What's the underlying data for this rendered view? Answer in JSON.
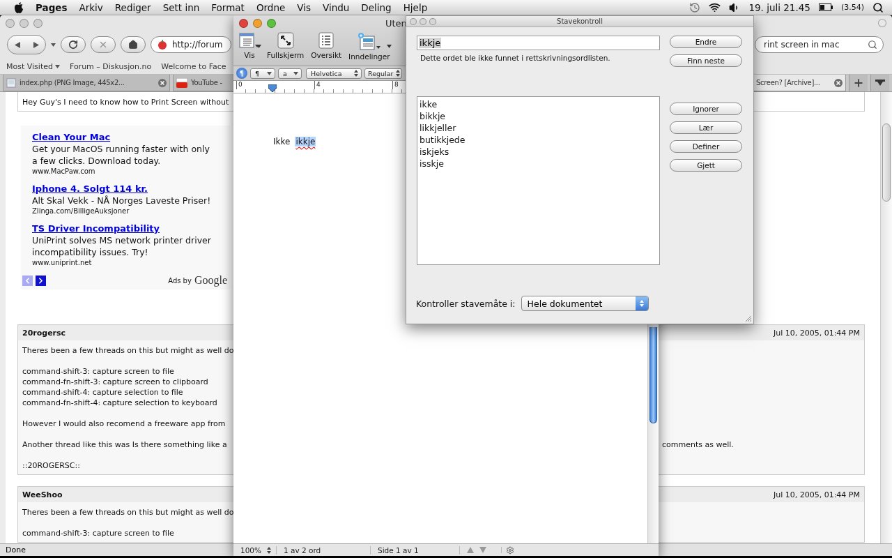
{
  "menu_bar": {
    "app": "Pages",
    "items": [
      "Arkiv",
      "Rediger",
      "Sett inn",
      "Format",
      "Ordne",
      "Vis",
      "Vindu",
      "Deling",
      "Hjelp"
    ],
    "clock": "19. juli 21.45",
    "battery": "(3.54)"
  },
  "browser": {
    "url": "http://forum",
    "search": "rint screen in mac",
    "bookmarks": [
      {
        "label": "Most Visited",
        "menu": true
      },
      {
        "label": "Forum – Diskusjon.no",
        "menu": false
      },
      {
        "label": "Welcome to Face",
        "menu": false
      }
    ],
    "tabs": [
      {
        "label": "index.php (PNG Image, 445x2...",
        "kind": "image",
        "selected": false,
        "close_button": true
      },
      {
        "label": "YouTube -",
        "kind": "video",
        "selected": false
      },
      {
        "label": "Screen? [Archive]...",
        "kind": "page",
        "selected": true,
        "close_button": true
      }
    ],
    "first_post_tail": "Hey Guy's I need to know how to Print Screen without",
    "ads": [
      {
        "title": "Clean Your Mac",
        "text": "Get your MacOS running faster with only a few clicks. Download today.",
        "url": "www.MacPaw.com"
      },
      {
        "title": "Iphone 4. Solgt 114 kr.",
        "text": "Alt Skal Vekk - NÅ Norges Laveste Priser!",
        "url": "Zlinga.com/BilligeAuksjoner"
      },
      {
        "title": "TS Driver Incompatibility",
        "text": "UniPrint solves MS network printer driver incompatibility issues. Try!",
        "url": "www.uniprint.net"
      }
    ],
    "ads_label": "Ads by",
    "ads_brand": "Google",
    "posts": [
      {
        "author": "20rogersc",
        "date": "Jul 10, 2005, 01:44 PM",
        "paragraphs": [
          {
            "lines": [
              "Theres been a few threads on this but might as well do"
            ]
          },
          {
            "lines": [
              "command-shift-3: capture screen to file",
              "command-fn-shift-3: capture screen to clipboard",
              "command-shift-4: capture selection to file",
              "command-fn-shift-4: capture selection to keyboard"
            ]
          },
          {
            "lines": [
              "However I would also recomend a freeware app from"
            ]
          },
          {
            "lines": [
              "Another thread like this was Is there something like a"
            ],
            "continued": "comments as well."
          },
          {
            "lines": [
              "::20ROGERSC::"
            ]
          }
        ]
      },
      {
        "author": "WeeShoo",
        "date": "Jul 10, 2005, 01:44 PM",
        "paragraphs": [
          {
            "lines": [
              "Theres been a few threads on this but might as well do"
            ]
          },
          {
            "lines": [
              "command-shift-3: capture screen to file"
            ]
          }
        ]
      }
    ],
    "status": "Done"
  },
  "pages": {
    "title": "Uten",
    "toolbar": [
      {
        "label": "Vis",
        "kind": "view",
        "menu": true
      },
      {
        "label": "Fullskjerm",
        "kind": "fullscreen",
        "menu": false
      },
      {
        "label": "Oversikt",
        "kind": "inspector",
        "menu": false
      },
      {
        "label": "Inndelinger",
        "kind": "sections",
        "menu": true
      }
    ],
    "format_bar": {
      "paragraph_button": "¶",
      "paragraph_style": "¶",
      "char_style": "a",
      "font": "Helvetica",
      "typeface": "Regular"
    },
    "ruler": [
      "0",
      "4",
      "8"
    ],
    "document": [
      {
        "text": "Ikke",
        "misspelled": false,
        "selected": false
      },
      {
        "text": "ikkje",
        "misspelled": true,
        "selected": true
      }
    ],
    "status": {
      "zoom": "100%",
      "words": "1 av 2 ord",
      "page": "Side 1 av 1"
    }
  },
  "spelling": {
    "title": "Stavekontroll",
    "word": "ikkje",
    "word_selected": true,
    "message": "Dette ordet ble ikke funnet i rettskrivningsordlisten.",
    "top_buttons": [
      "Endre",
      "Finn neste"
    ],
    "guesses": [
      {
        "text": "ikke",
        "selected": false
      },
      {
        "text": "bikkje",
        "selected": false
      },
      {
        "text": "likkjeller",
        "selected": false
      },
      {
        "text": "butikkjede",
        "selected": false
      },
      {
        "text": "iskjeks",
        "selected": false
      },
      {
        "text": "isskje",
        "selected": false
      }
    ],
    "buttons": [
      "Ignorer",
      "Lær",
      "Definer",
      "Gjett"
    ],
    "scope_label": "Kontroller stavemåte i:",
    "scope": "Hele dokumentet"
  }
}
